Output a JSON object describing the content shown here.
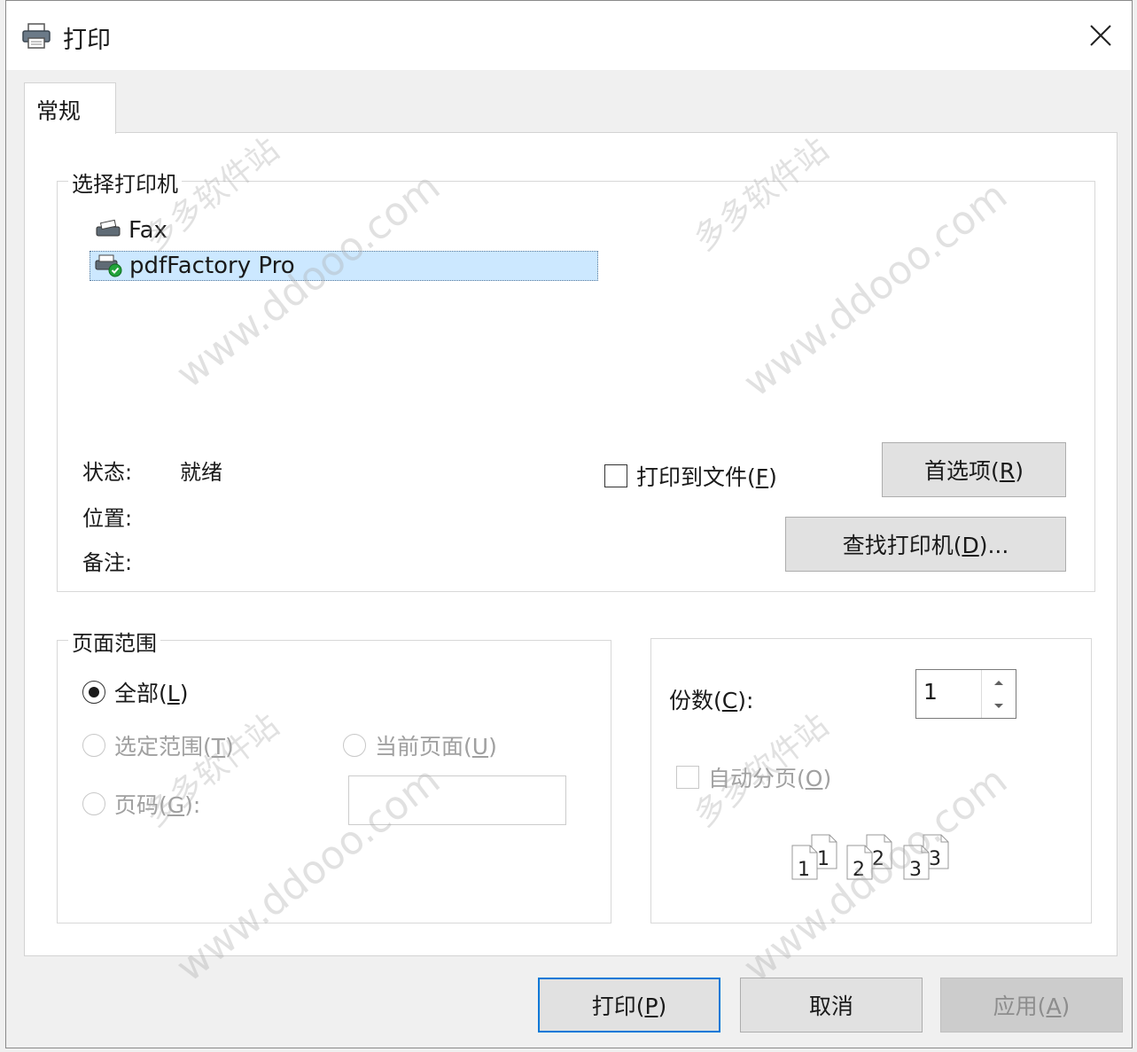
{
  "window": {
    "title": "打印",
    "icon": "printer-icon"
  },
  "tabs": [
    {
      "label": "常规",
      "active": true
    }
  ],
  "printer_group": {
    "legend": "选择打印机",
    "printers": [
      {
        "name": "Fax",
        "icon": "fax-printer-icon",
        "selected": false
      },
      {
        "name": "pdfFactory Pro",
        "icon": "default-printer-icon",
        "selected": true
      }
    ],
    "status_label": "状态:",
    "status_value": "就绪",
    "location_label": "位置:",
    "comment_label": "备注:",
    "print_to_file": {
      "label": "打印到文件(",
      "hotkey": "F",
      "suffix": ")",
      "checked": false
    },
    "preferences_button": {
      "label": "首选项(",
      "hotkey": "R",
      "suffix": ")"
    },
    "find_printer_button": {
      "label": "查找打印机(",
      "hotkey": "D",
      "suffix": ")..."
    }
  },
  "page_range": {
    "legend": "页面范围",
    "all": {
      "label": "全部(",
      "hotkey": "L",
      "suffix": ")",
      "checked": true
    },
    "selection": {
      "label": "选定范围(",
      "hotkey": "T",
      "suffix": ")",
      "enabled": false
    },
    "current_page": {
      "label": "当前页面(",
      "hotkey": "U",
      "suffix": ")",
      "enabled": false
    },
    "pages": {
      "label": "页码(",
      "hotkey": "G",
      "suffix": "):",
      "enabled": false,
      "value": ""
    }
  },
  "copies": {
    "label": "份数(",
    "hotkey": "C",
    "suffix": "):",
    "value": "1",
    "collate": {
      "label": "自动分页(",
      "hotkey": "O",
      "suffix": ")",
      "checked": false,
      "enabled": false
    },
    "collate_pages": [
      "1",
      "1",
      "2",
      "2",
      "3",
      "3"
    ]
  },
  "buttons": {
    "print": {
      "label": "打印(",
      "hotkey": "P",
      "suffix": ")"
    },
    "cancel": {
      "label": "取消"
    },
    "apply": {
      "label": "应用(",
      "hotkey": "A",
      "suffix": ")",
      "enabled": false
    }
  },
  "watermarks": [
    "多多软件站",
    "www.ddooo.com",
    "多多软件站",
    "www.ddooo.com",
    "多多软件站",
    "www.ddooo.com",
    "多多软件站",
    "www.ddooo.com"
  ],
  "colors": {
    "selection": "#cce8ff",
    "default_button_border": "#0078d7",
    "dialog_bg": "#f0f0f0"
  }
}
